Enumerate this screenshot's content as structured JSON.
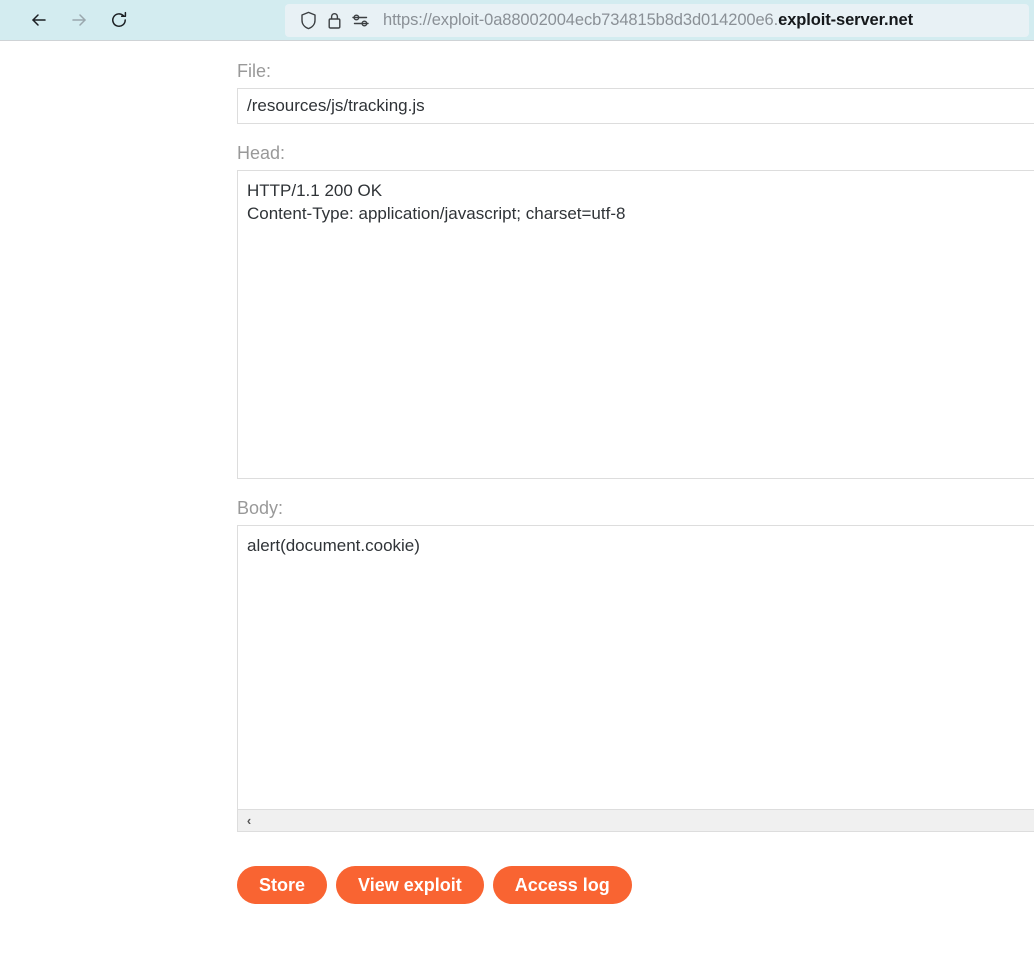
{
  "browser": {
    "back_icon": "back-arrow-icon",
    "forward_icon": "forward-arrow-icon",
    "reload_icon": "reload-icon",
    "shield_icon": "shield-icon",
    "lock_icon": "padlock-icon",
    "permissions_icon": "permissions-icon",
    "url_prefix": "https://exploit-0a88002004ecb734815b8d3d014200e6.",
    "url_domain": "exploit-server.net",
    "url_full": "https://exploit-0a88002004ecb734815b8d3d014200e6.exploit-server.net",
    "toolbar_bg": "#d3ecf0",
    "urlbar_bg": "#e8f1f5"
  },
  "form": {
    "file": {
      "label": "File:",
      "value": "/resources/js/tracking.js",
      "placeholder": ""
    },
    "head": {
      "label": "Head:",
      "value": "HTTP/1.1 200 OK\nContent-Type: application/javascript; charset=utf-8",
      "placeholder": ""
    },
    "body": {
      "label": "Body:",
      "value": "alert(document.cookie)",
      "placeholder": ""
    },
    "scrollbar": {
      "left_arrow": "‹"
    }
  },
  "buttons": {
    "accent_color": "#f96432",
    "store": "Store",
    "view_exploit": "View exploit",
    "access_log": "Access log"
  }
}
